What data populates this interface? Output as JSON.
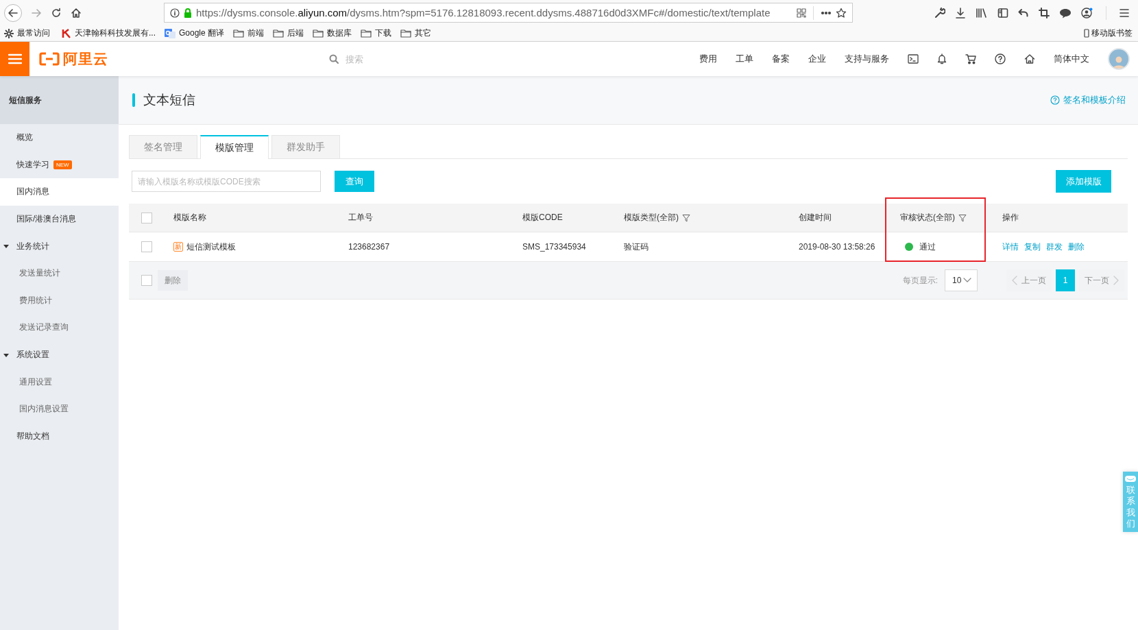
{
  "browser": {
    "url": "https://dysms.console.**aliyun.com**/dysms.htm?spm=5176.12818093.recent.ddysms.488716d0d3XMFc#/domestic/text/template",
    "bookmarks": [
      {
        "label": "最常访问",
        "kind": "gear"
      },
      {
        "label": "天津翰科科技发展有...",
        "kind": "site"
      },
      {
        "label": "Google 翻译",
        "kind": "translate"
      },
      {
        "label": "前端",
        "kind": "folder"
      },
      {
        "label": "后端",
        "kind": "folder"
      },
      {
        "label": "数据库",
        "kind": "folder"
      },
      {
        "label": "下载",
        "kind": "folder"
      },
      {
        "label": "其它",
        "kind": "folder"
      }
    ],
    "mobile_bookmarks": "移动版书签"
  },
  "header": {
    "logo": "阿里云",
    "search": {
      "placeholder": "搜索"
    },
    "nav": [
      "费用",
      "工单",
      "备案",
      "企业",
      "支持与服务"
    ],
    "language": "简体中文"
  },
  "sidebar": {
    "title": "短信服务",
    "items": [
      {
        "label": "概览",
        "selected": false
      },
      {
        "label": "快速学习",
        "badge": "NEW",
        "selected": false
      },
      {
        "label": "国内消息",
        "selected": true
      },
      {
        "label": "国际/港澳台消息",
        "selected": false
      },
      {
        "label": "业务统计",
        "selected": false,
        "expanded": true,
        "children": [
          {
            "label": "发送量统计",
            "selected": false
          },
          {
            "label": "费用统计",
            "selected": false
          },
          {
            "label": "发送记录查询",
            "selected": false
          }
        ]
      },
      {
        "label": "系统设置",
        "selected": false,
        "expanded": true,
        "children": [
          {
            "label": "通用设置",
            "selected": false
          },
          {
            "label": "国内消息设置",
            "selected": false
          }
        ]
      },
      {
        "label": "帮助文档",
        "selected": false
      }
    ]
  },
  "page": {
    "title": "文本短信",
    "help_link": "签名和模板介绍",
    "tabs": [
      {
        "label": "签名管理",
        "selected": false
      },
      {
        "label": "模版管理",
        "selected": true
      },
      {
        "label": "群发助手",
        "selected": false
      }
    ],
    "search": {
      "placeholder": "请输入模版名称或模版CODE搜索"
    },
    "query_button": "查询",
    "add_button": "添加模版",
    "table": {
      "select_all": {
        "checked": false
      },
      "columns": [
        {
          "label": "模版名称",
          "filter": false,
          "highlighted": false
        },
        {
          "label": "工单号",
          "filter": false,
          "highlighted": false
        },
        {
          "label": "模版CODE",
          "filter": false,
          "highlighted": false
        },
        {
          "label": "模版类型(全部)",
          "filter": true,
          "highlighted": false
        },
        {
          "label": "创建时间",
          "filter": false,
          "highlighted": false
        },
        {
          "label": "审核状态(全部)",
          "filter": true,
          "highlighted": true
        },
        {
          "label": "操作",
          "filter": false,
          "highlighted": false
        }
      ],
      "rows": [
        {
          "selected": false,
          "tag": "新",
          "name": "短信测试模板",
          "order_no": "123682367",
          "code": "SMS_173345934",
          "type": "验证码",
          "created": "2019-08-30 13:58:26",
          "status": {
            "label": "通过",
            "color": "#2db84d"
          },
          "actions": [
            "详情",
            "复制",
            "群发",
            "删除"
          ]
        }
      ]
    },
    "footer": {
      "select_all": {
        "checked": false
      },
      "delete_button": {
        "label": "删除",
        "disabled": true
      },
      "page_size_label": "每页显示:",
      "page_size": "10",
      "prev": {
        "label": "上一页",
        "disabled": true
      },
      "pages": [
        {
          "label": "1",
          "selected": true
        }
      ],
      "next": {
        "label": "下一页",
        "disabled": true
      }
    }
  },
  "contact": "联系我们"
}
